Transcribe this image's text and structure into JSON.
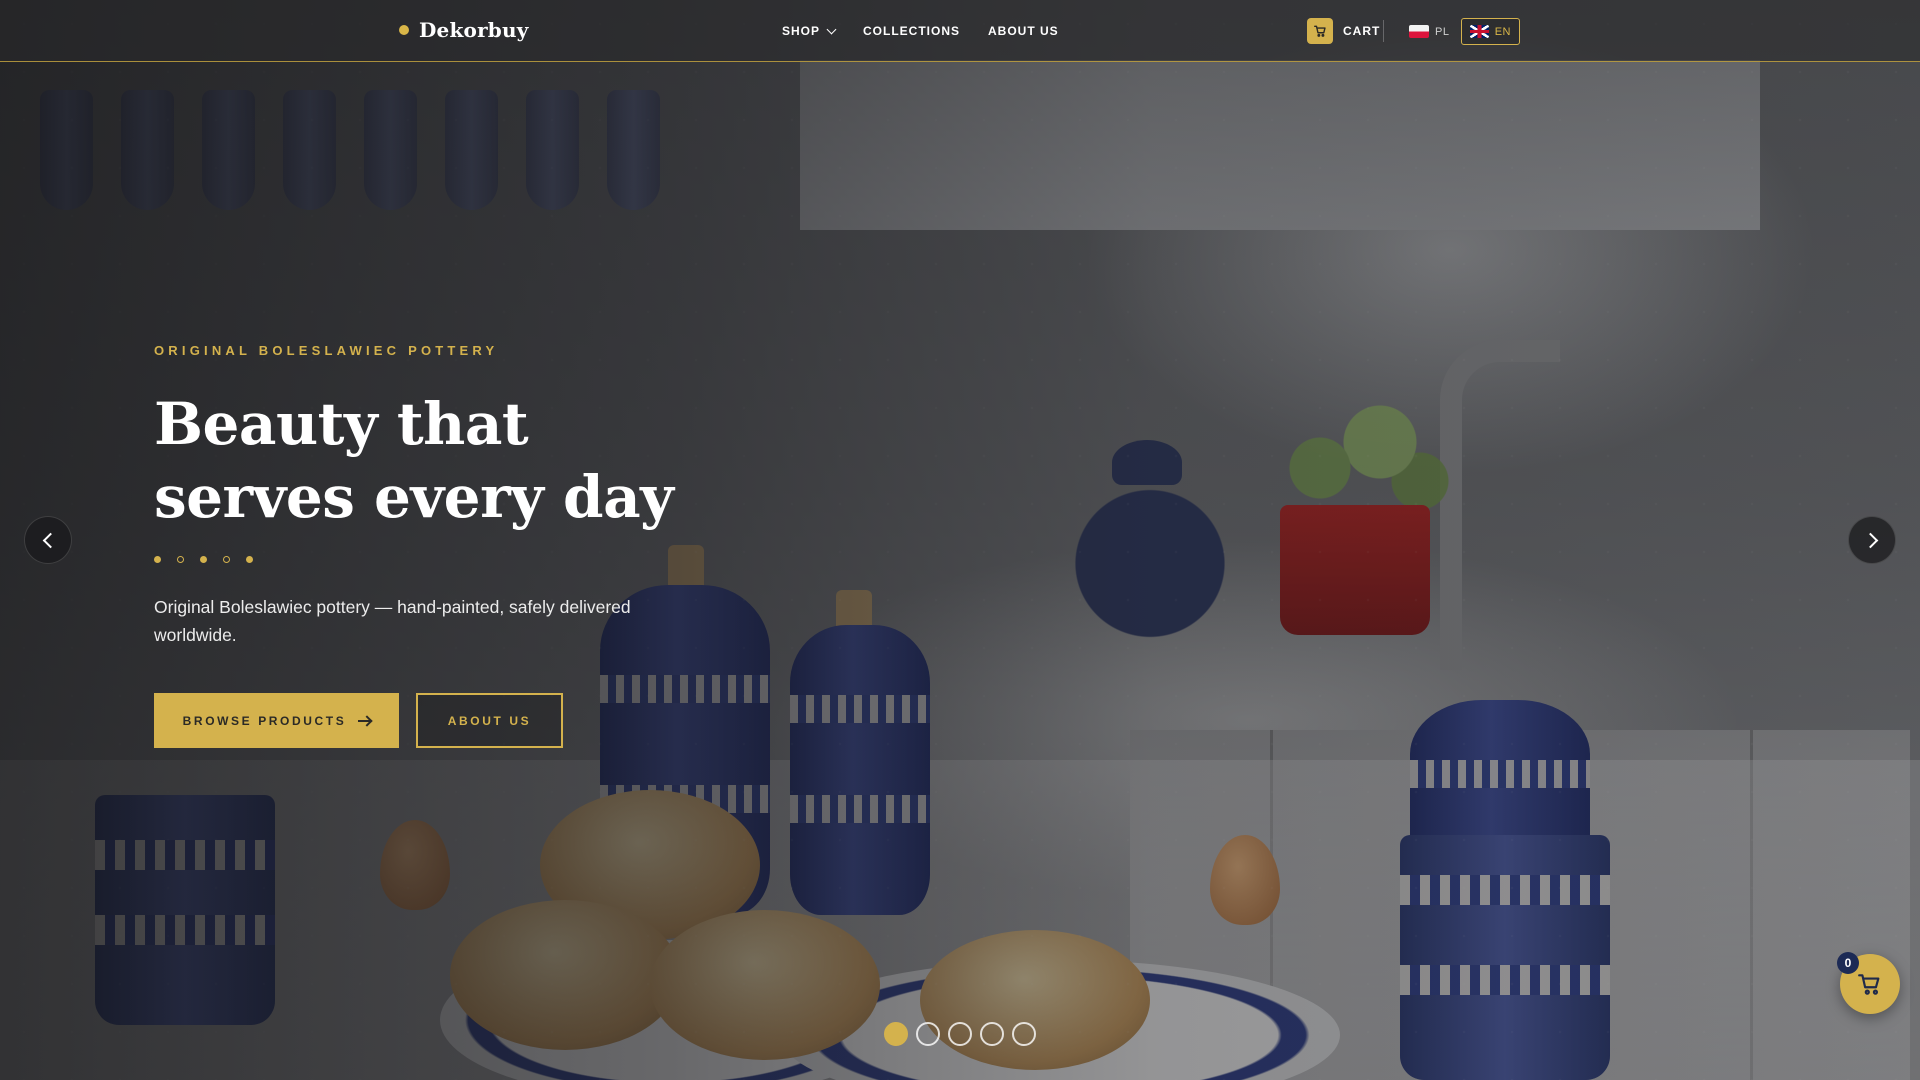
{
  "header": {
    "brand": "Dekorbuy",
    "nav": [
      {
        "label": "SHOP",
        "has_dropdown": true
      },
      {
        "label": "COLLECTIONS"
      },
      {
        "label": "ABOUT US"
      }
    ],
    "cart_label": "CART",
    "languages": [
      {
        "code": "PL",
        "active": false
      },
      {
        "code": "EN",
        "active": true
      }
    ]
  },
  "hero": {
    "eyebrow": "ORIGINAL BOLESLAWIEC POTTERY",
    "headline": "Beauty that serves every day",
    "subtitle": "Original Boleslawiec pottery — hand-painted, safely delivered worldwide.",
    "primary_cta": "BROWSE PRODUCTS",
    "secondary_cta": "ABOUT US"
  },
  "slider": {
    "slide_count": 5,
    "active_index": 0
  },
  "floating_cart": {
    "count": "0"
  },
  "colors": {
    "accent": "#d4b24d",
    "badge": "#1c2a55",
    "text": "#ffffff"
  },
  "icons": [
    "cart-icon",
    "chevron-down-icon",
    "flag-pl-icon",
    "flag-uk-icon",
    "arrow-right-icon",
    "chevron-left-icon",
    "chevron-right-icon"
  ]
}
